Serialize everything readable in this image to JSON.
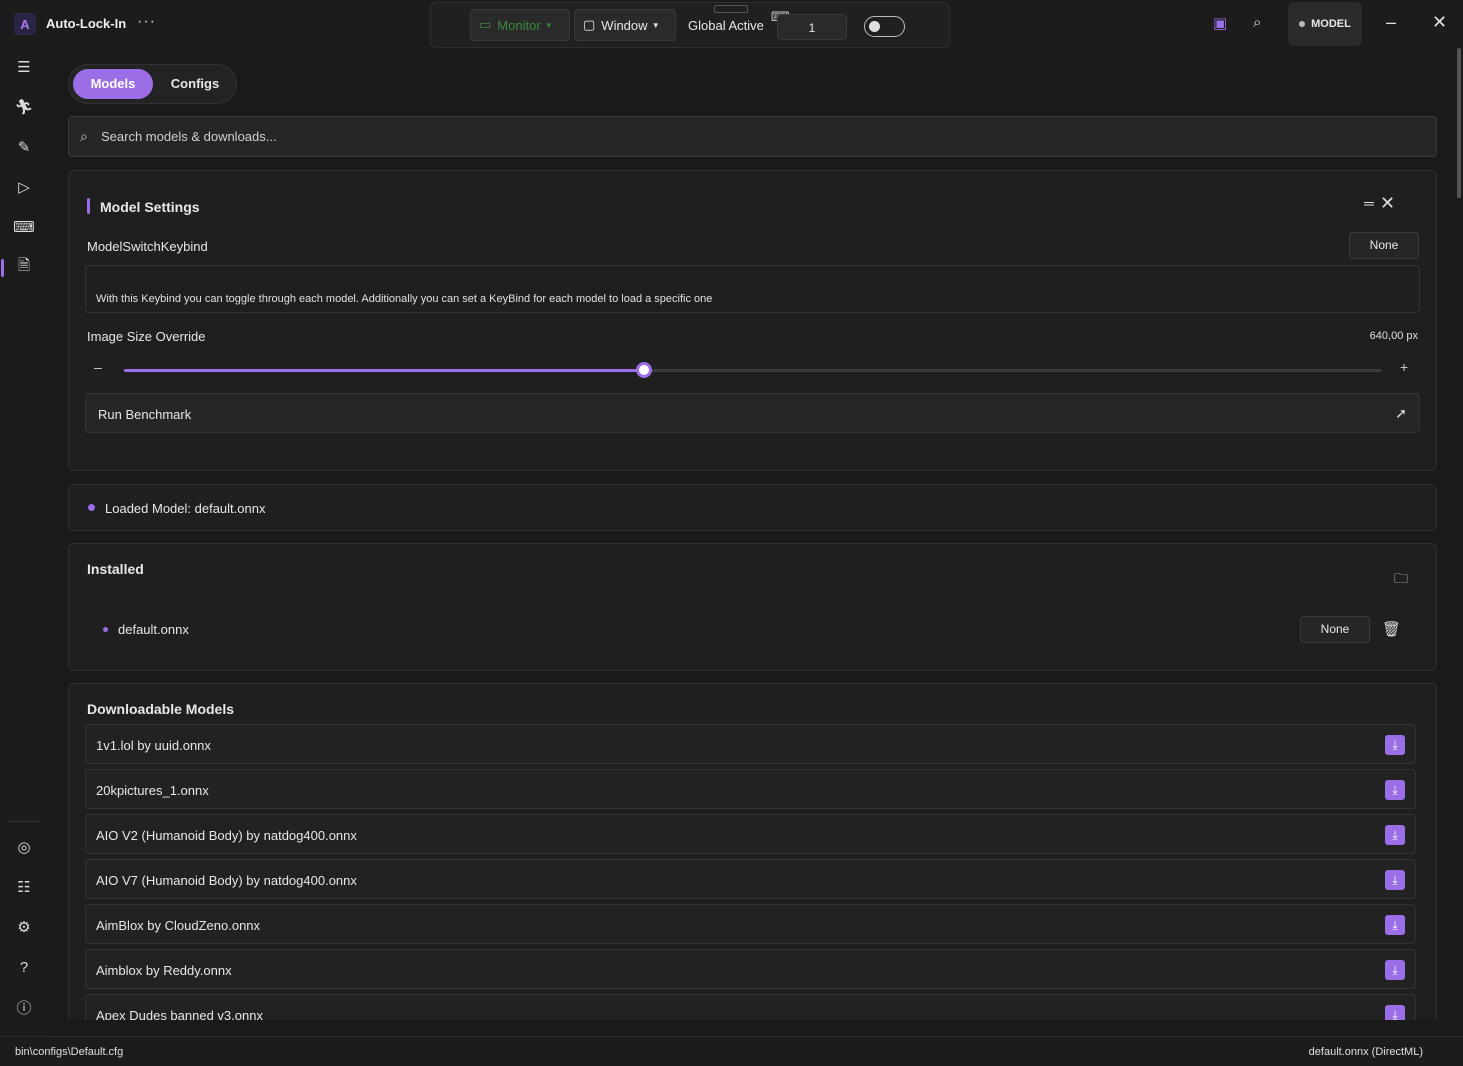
{
  "app": {
    "title": "Auto-Lock-In",
    "logo": "A",
    "more": "···"
  },
  "toolbar": {
    "monitor_label": "Monitor",
    "window_label": "Window",
    "global_active_label": "Global Active",
    "value": "1",
    "toggle_on": false
  },
  "header": {
    "model_badge": "MODEL"
  },
  "tabs": [
    {
      "label": "Models",
      "active": true
    },
    {
      "label": "Configs",
      "active": false
    }
  ],
  "search": {
    "placeholder": "Search models & downloads..."
  },
  "model_settings": {
    "title": "Model Settings",
    "keybind_label": "ModelSwitchKeybind",
    "keybind_value": "None",
    "description": "With this Keybind you can toggle through each model. Additionally you can set a KeyBind for each model to load a specific one",
    "image_size_label": "Image Size Override",
    "image_size_value": "640,00 px",
    "slider_fraction": 0.413,
    "benchmark_label": "Run Benchmark"
  },
  "loaded_model": {
    "text": "Loaded Model: default.onnx"
  },
  "installed": {
    "title": "Installed",
    "items": [
      {
        "name": "default.onnx",
        "keybind": "None"
      }
    ]
  },
  "downloadable": {
    "title": "Downloadable Models",
    "items": [
      "1v1.lol by uuid.onnx",
      "20kpictures_1.onnx",
      "AIO V2 (Humanoid Body) by natdog400.onnx",
      "AIO V7 (Humanoid Body) by natdog400.onnx",
      "AimBlox by CloudZeno.onnx",
      "Aimblox by Reddy.onnx",
      "Apex Dudes banned v3.onnx"
    ]
  },
  "status": {
    "config_path": "bin\\configs\\Default.cfg",
    "model_info": "default.onnx (DirectML)"
  },
  "colors": {
    "accent": "#9b6ee8",
    "monitor_green": "#3a8a3a",
    "background": "#1a1a1a"
  },
  "icons": {
    "sidebar_top": [
      "hamburger-icon",
      "aim-figure-icon",
      "wrench-icon",
      "play-icon",
      "keyboard-icon",
      "model-file-icon"
    ],
    "sidebar_bottom": [
      "gamepad-icon",
      "checklist-icon",
      "gear-icon",
      "help-icon",
      "info-icon"
    ]
  }
}
